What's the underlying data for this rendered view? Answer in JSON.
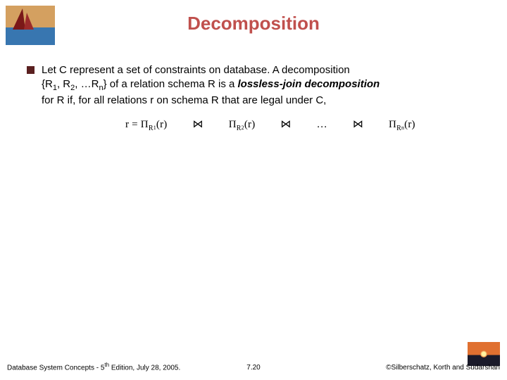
{
  "title": "Decomposition",
  "bullet": {
    "line1a": "Let C represent a set of constraints on database. A decomposition",
    "line2a": "{R",
    "sub1": "1",
    "line2b": ", R",
    "sub2": "2",
    "line2c": ", …R",
    "subn": "n",
    "line2d": "} of a relation schema R is a ",
    "lossless": "lossless-join decomposition",
    "line3": "for R if, for all relations r on schema R that are legal under C,"
  },
  "formula": {
    "r_eq": "r = ",
    "Pi": "Π",
    "R": "R",
    "s1": "1",
    "s2": "2",
    "sn": "n",
    "of_r": "(r)",
    "join": "⋈",
    "dots": "…"
  },
  "footer": {
    "left_a": "Database System Concepts - 5",
    "left_sup": "th",
    "left_b": " Edition, July 28,  2005.",
    "center": "7.20",
    "right": "©Silberschatz, Korth and Sudarshan"
  }
}
